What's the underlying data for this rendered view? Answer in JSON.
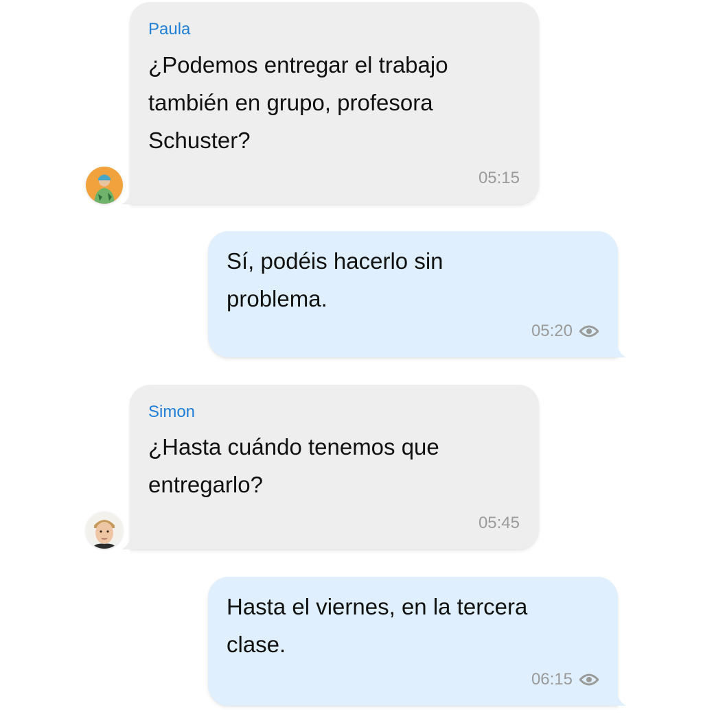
{
  "messages": [
    {
      "direction": "incoming",
      "sender": "Paula",
      "text": "¿Podemos entregar el trabajo\ntambién en grupo, profesora\nSchuster?",
      "time": "05:15",
      "avatar": "paula-avatar"
    },
    {
      "direction": "outgoing",
      "text": "Sí, podéis hacerlo sin\nproblema.",
      "time": "05:20",
      "status_icon": "eye-icon"
    },
    {
      "direction": "incoming",
      "sender": "Simon",
      "text": "¿Hasta cuándo tenemos que\nentregarlo?",
      "time": "05:45",
      "avatar": "simon-avatar"
    },
    {
      "direction": "outgoing",
      "text": "Hasta el viernes, en la tercera\nclase.",
      "time": "06:15",
      "status_icon": "eye-icon"
    }
  ],
  "colors": {
    "incoming_bubble": "#eeeeee",
    "outgoing_bubble": "#dfeffd",
    "sender_name": "#1f7fd6",
    "timestamp": "#9a9a9a",
    "message_text": "#111111"
  }
}
